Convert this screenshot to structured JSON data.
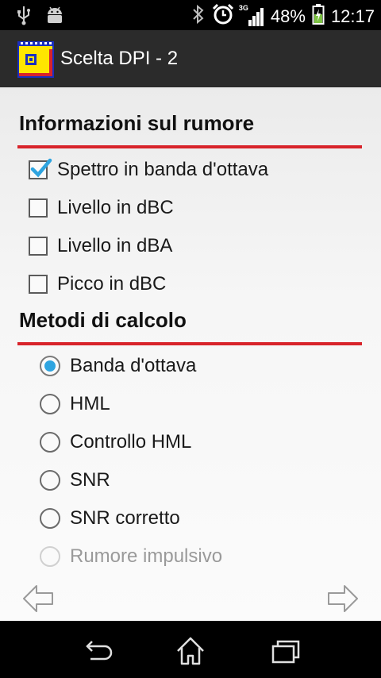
{
  "status_bar": {
    "battery_percent": "48%",
    "time": "12:17",
    "network": "3G",
    "icons": [
      "usb-icon",
      "android-debug-icon",
      "bluetooth-icon",
      "alarm-icon",
      "signal-icon",
      "battery-charging-icon"
    ]
  },
  "action_bar": {
    "title": "Scelta DPI - 2",
    "logo_icon": "app-logo-icon"
  },
  "noise_section": {
    "title": "Informazioni sul rumore",
    "options": [
      {
        "label": "Spettro in banda d'ottava",
        "checked": true
      },
      {
        "label": "Livello in dBC",
        "checked": false
      },
      {
        "label": "Livello in dBA",
        "checked": false
      },
      {
        "label": "Picco in dBC",
        "checked": false
      }
    ]
  },
  "methods_section": {
    "title": "Metodi di calcolo",
    "options": [
      {
        "label": "Banda d'ottava",
        "selected": true,
        "enabled": true
      },
      {
        "label": "HML",
        "selected": false,
        "enabled": true
      },
      {
        "label": "Controllo HML",
        "selected": false,
        "enabled": true
      },
      {
        "label": "SNR",
        "selected": false,
        "enabled": true
      },
      {
        "label": "SNR corretto",
        "selected": false,
        "enabled": true
      },
      {
        "label": "Rumore impulsivo",
        "selected": false,
        "enabled": false
      }
    ]
  },
  "navigation": {
    "back_arrow_icon": "arrow-left-icon",
    "forward_arrow_icon": "arrow-right-icon"
  },
  "system_nav": {
    "icons": [
      "back-icon",
      "home-icon",
      "recent-apps-icon"
    ]
  },
  "colors": {
    "accent_rule": "#d8232a",
    "radio_selected": "#2ea4e0",
    "checkmark": "#2ea4e0"
  }
}
